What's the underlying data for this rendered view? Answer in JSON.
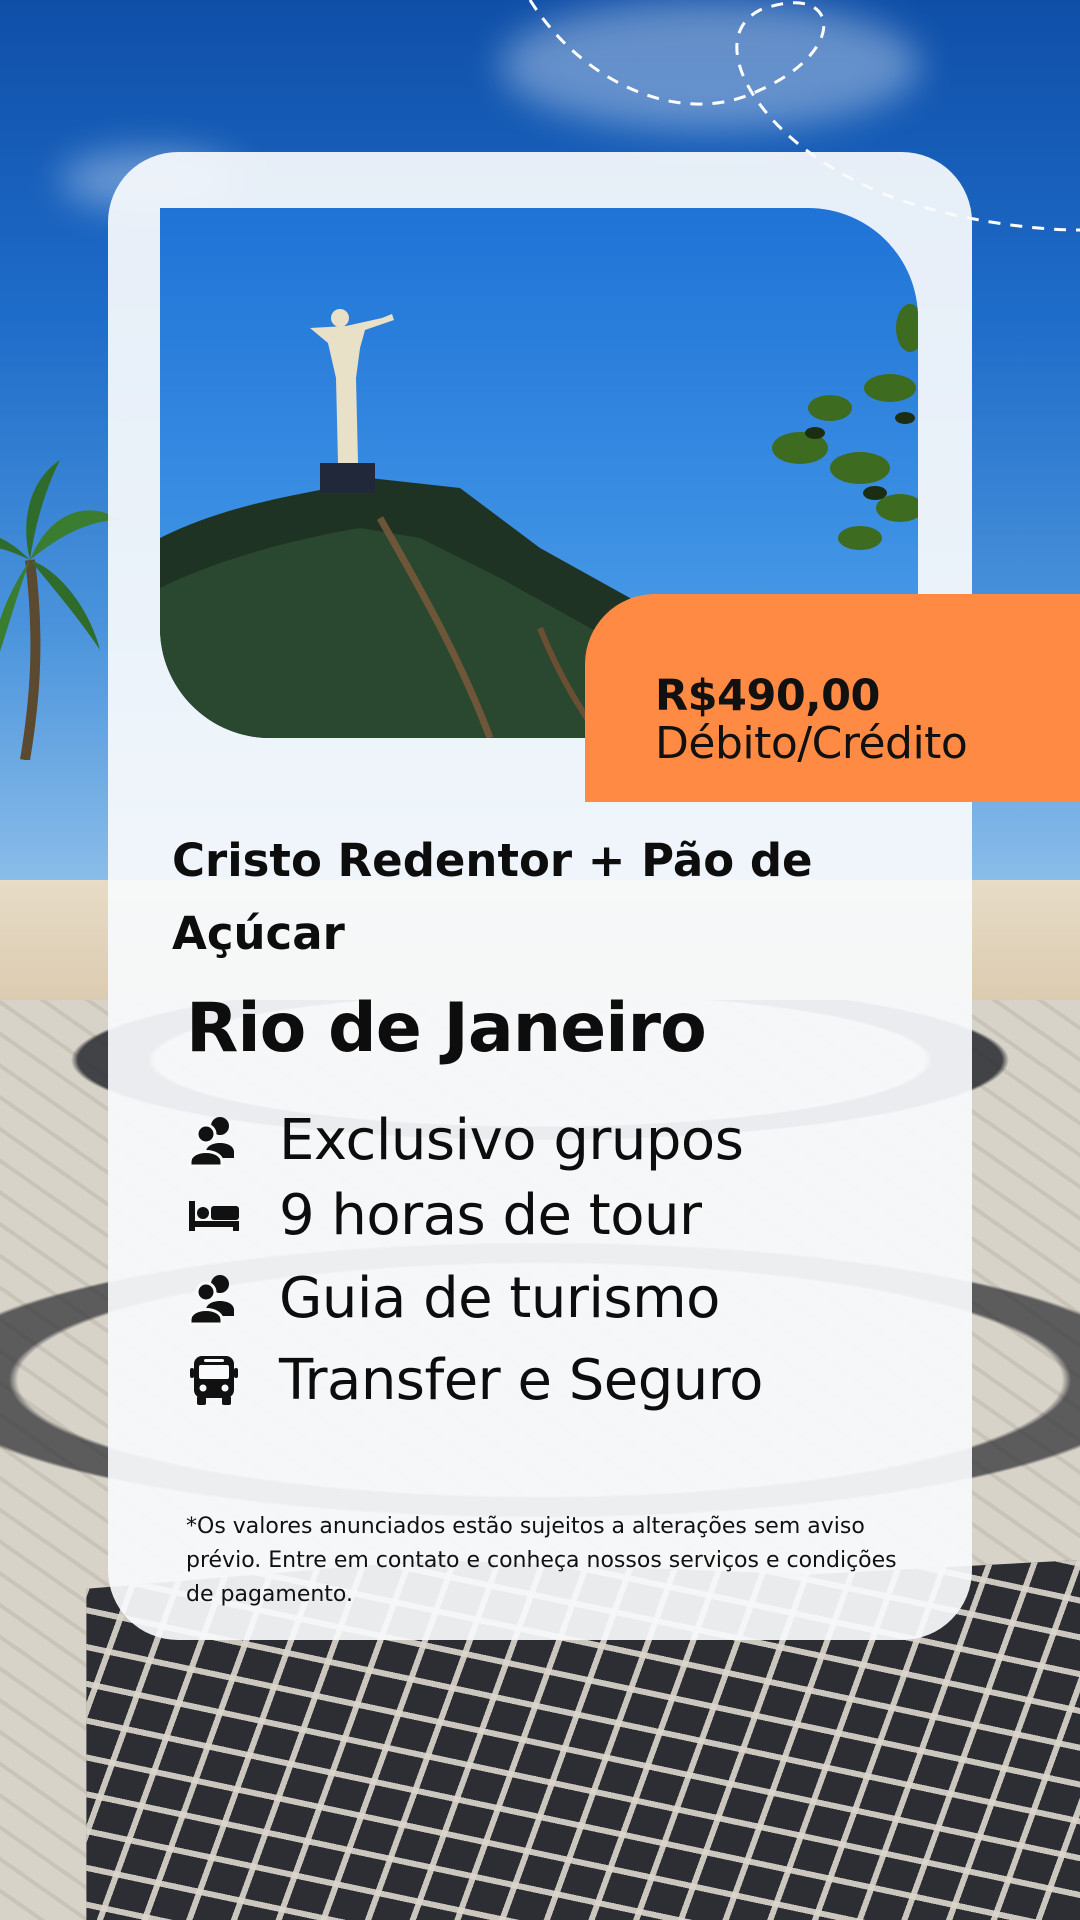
{
  "offer": {
    "price": "R$490,00",
    "payment": "Débito/Crédito"
  },
  "tour": {
    "title": "Cristo Redentor + Pão de Açúcar",
    "city": "Rio de Janeiro"
  },
  "features": [
    {
      "icon": "group-icon",
      "label": "Exclusivo grupos"
    },
    {
      "icon": "bed-icon",
      "label": "9 horas de tour"
    },
    {
      "icon": "group-icon",
      "label": "Guia de turismo"
    },
    {
      "icon": "bus-icon",
      "label": "Transfer e Seguro"
    }
  ],
  "disclaimer": "*Os valores anunciados estão sujeitos a alterações sem aviso prévio. Entre em contato e conheça nossos serviços e condições de pagamento.",
  "colors": {
    "accent": "#ff8a43",
    "card": "#f8fafc",
    "text": "#0d0d0d",
    "sky": "#1e6cc9"
  }
}
